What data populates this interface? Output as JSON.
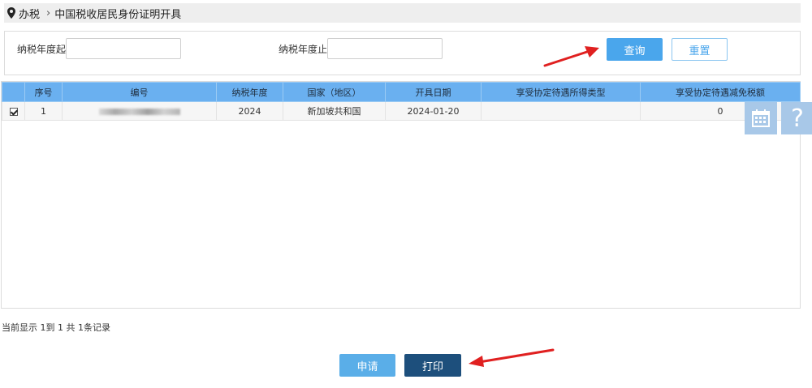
{
  "breadcrumb": {
    "root": "办税",
    "separator": "›",
    "current": "中国税收居民身份证明开具"
  },
  "filter": {
    "year_from_label": "纳税年度起:",
    "year_from_value": "",
    "year_to_label": "纳税年度止:",
    "year_to_value": "",
    "query_label": "查询",
    "reset_label": "重置"
  },
  "table": {
    "columns": [
      "",
      "序号",
      "编号",
      "纳税年度",
      "国家（地区）",
      "开具日期",
      "享受协定待遇所得类型",
      "享受协定待遇减免税额"
    ],
    "rows": [
      {
        "checked": true,
        "index": "1",
        "number": "",
        "year": "2024",
        "country": "新加坡共和国",
        "issue_date": "2024-01-20",
        "income_type": "",
        "relief_amount": "0"
      }
    ]
  },
  "side_tools": {
    "calendar_icon": "calendar-icon",
    "help_icon": "help-icon",
    "help_glyph": "?"
  },
  "footer": {
    "record_info": "当前显示 1到 1 共 1条记录",
    "apply_label": "申请",
    "print_label": "打印"
  },
  "colors": {
    "accent": "#4aa6ec",
    "table_header": "#6ab0f0",
    "print_button": "#1d4f7c",
    "annotation_arrow": "#e02020"
  }
}
